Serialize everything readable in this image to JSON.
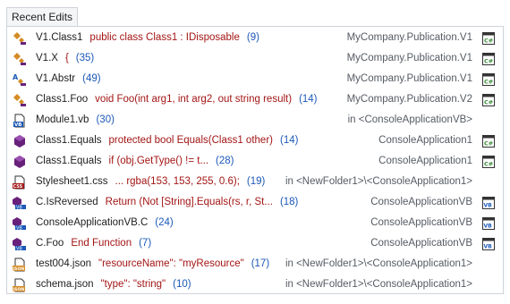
{
  "tab": {
    "label": "Recent Edits"
  },
  "rows": [
    {
      "icon": "class-member-icon",
      "name": "V1.Class1",
      "code": "public class Class1 : IDisposable",
      "count": "(9)",
      "location": "MyCompany.Publication.V1",
      "project_icon": "csharp-project-icon"
    },
    {
      "icon": "class-member-icon",
      "name": "V1.X",
      "code": "{",
      "count": "(35)",
      "location": "MyCompany.Publication.V1",
      "project_icon": "csharp-project-icon"
    },
    {
      "icon": "abstract-class-icon",
      "name": "V1.Abstr",
      "code": "",
      "count": "(49)",
      "location": "MyCompany.Publication.V1",
      "project_icon": "csharp-project-icon"
    },
    {
      "icon": "class-member-icon",
      "name": "Class1.Foo",
      "code": "void Foo(int arg1, int arg2, out string result)",
      "count": "(14)",
      "location": "MyCompany.Publication.V2",
      "project_icon": "csharp-project-icon"
    },
    {
      "icon": "vb-file-icon",
      "name": "Module1.vb",
      "code": "",
      "count": "(30)",
      "location": "in <ConsoleApplicationVB>",
      "project_icon": ""
    },
    {
      "icon": "method-icon",
      "name": "Class1.Equals",
      "code": "protected bool Equals(Class1 other)",
      "count": "(14)",
      "location": "ConsoleApplication1",
      "project_icon": "csharp-project-icon"
    },
    {
      "icon": "method-icon",
      "name": "Class1.Equals",
      "code": "if (obj.GetType() != t...",
      "count": "(28)",
      "location": "ConsoleApplication1",
      "project_icon": "csharp-project-icon"
    },
    {
      "icon": "css-file-icon",
      "name": "Stylesheet1.css",
      "code": "... rgba(153, 153, 255, 0.6);",
      "count": "(19)",
      "location": "in <NewFolder1>\\<ConsoleApplication1>",
      "project_icon": ""
    },
    {
      "icon": "vb-method-icon",
      "name": "C.IsReversed",
      "code": "Return (Not [String].Equals(rs, r, St...",
      "count": "(18)",
      "location": "ConsoleApplicationVB",
      "project_icon": "vb-project-icon"
    },
    {
      "icon": "vb-method-icon",
      "name": "ConsoleApplicationVB.C",
      "code": "",
      "count": "(24)",
      "location": "ConsoleApplicationVB",
      "project_icon": "vb-project-icon"
    },
    {
      "icon": "vb-method-icon",
      "name": "C.Foo",
      "code": "End Function",
      "count": "(7)",
      "location": "ConsoleApplicationVB",
      "project_icon": "vb-project-icon"
    },
    {
      "icon": "json-file-icon",
      "name": "test004.json",
      "code": "\"resourceName\": \"myResource\"",
      "count": "(17)",
      "location": "in <NewFolder1>\\<ConsoleApplication1>",
      "project_icon": ""
    },
    {
      "icon": "json-file-icon",
      "name": "schema.json",
      "code": "\"type\": \"string\"",
      "count": "(10)",
      "location": "in <NewFolder1>\\<ConsoleApplication1>",
      "project_icon": ""
    }
  ],
  "colors": {
    "code": "#a31515",
    "count": "#1b58b8",
    "location": "#555b63",
    "icon_purple": "#68217a",
    "icon_orange": "#d48c25",
    "icon_blue": "#1b58b8",
    "project_green": "#388a34"
  }
}
